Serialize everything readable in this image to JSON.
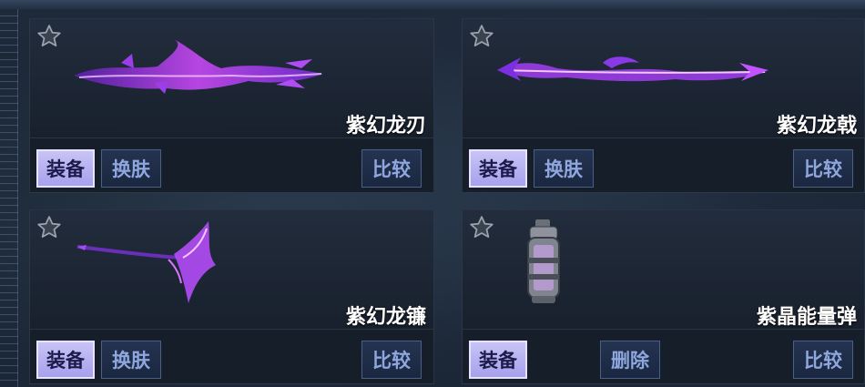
{
  "colors": {
    "primary_button_bg": "#b4aef0",
    "secondary_button_bg": "#1f2c46",
    "secondary_button_text": "#8fa7df",
    "item_glow": "#b040ff"
  },
  "cards": [
    {
      "name": "紫幻龙刃",
      "art": "purple-dragon-blade-icon",
      "buttons": {
        "equip": "装备",
        "skin": "换肤",
        "compare": "比较"
      }
    },
    {
      "name": "紫幻龙戟",
      "art": "purple-dragon-halberd-icon",
      "buttons": {
        "equip": "装备",
        "skin": "换肤",
        "compare": "比较"
      }
    },
    {
      "name": "紫幻龙镰",
      "art": "purple-dragon-scythe-icon",
      "buttons": {
        "equip": "装备",
        "skin": "换肤",
        "compare": "比较"
      }
    },
    {
      "name": "紫晶能量弹",
      "art": "amethyst-energy-grenade-icon",
      "buttons": {
        "equip": "装备",
        "delete": "删除",
        "compare": "比较"
      }
    }
  ]
}
